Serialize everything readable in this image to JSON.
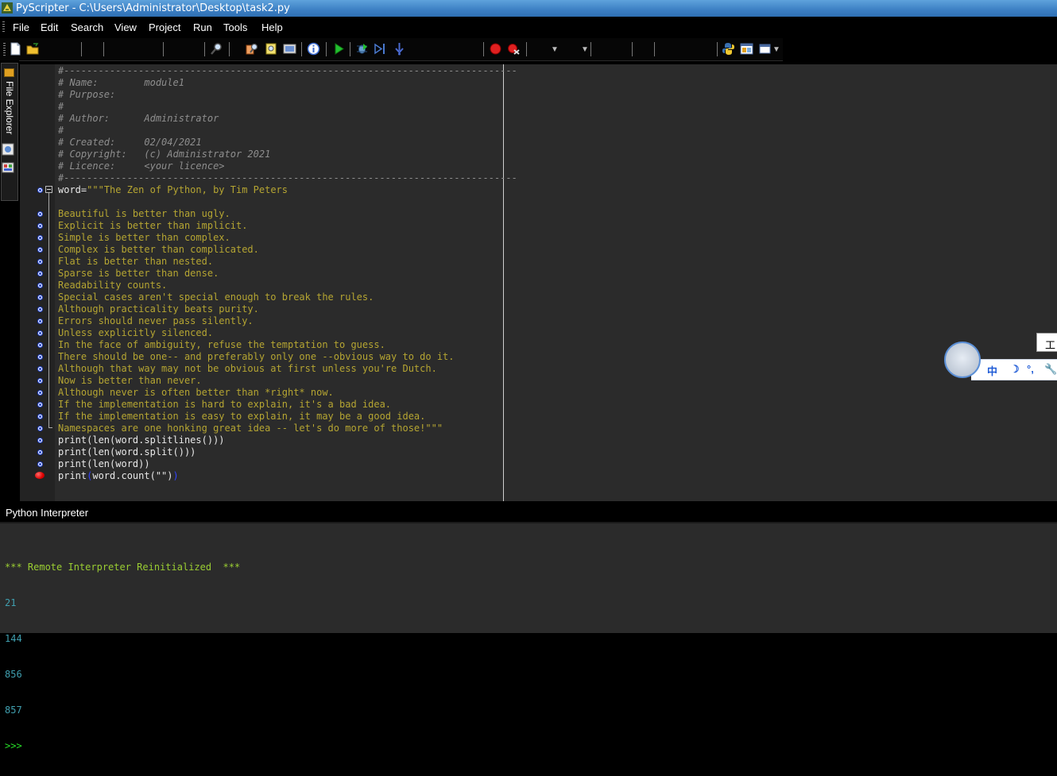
{
  "window": {
    "title": "PyScripter - C:\\Users\\Administrator\\Desktop\\task2.py"
  },
  "menu": [
    "File",
    "Edit",
    "Search",
    "View",
    "Project",
    "Run",
    "Tools",
    "Help"
  ],
  "side_tabs": {
    "file_explorer": "File Explorer"
  },
  "editor": {
    "header_comment": [
      "#-------------------------------------------------------------------------------",
      "# Name:        module1",
      "# Purpose:",
      "#",
      "# Author:      Administrator",
      "#",
      "# Created:     02/04/2021",
      "# Copyright:   (c) Administrator 2021",
      "# Licence:     <your licence>",
      "#-------------------------------------------------------------------------------"
    ],
    "assign_var": "word",
    "assign_eq": "=",
    "string_first": "\"\"\"The Zen of Python, by Tim Peters",
    "string_lines": [
      "",
      "Beautiful is better than ugly.",
      "Explicit is better than implicit.",
      "Simple is better than complex.",
      "Complex is better than complicated.",
      "Flat is better than nested.",
      "Sparse is better than dense.",
      "Readability counts.",
      "Special cases aren't special enough to break the rules.",
      "Although practicality beats purity.",
      "Errors should never pass silently.",
      "Unless explicitly silenced.",
      "In the face of ambiguity, refuse the temptation to guess.",
      "There should be one-- and preferably only one --obvious way to do it.",
      "Although that way may not be obvious at first unless you're Dutch.",
      "Now is better than never.",
      "Although never is often better than *right* now.",
      "If the implementation is hard to explain, it's a bad idea.",
      "If the implementation is easy to explain, it may be a good idea.",
      "Namespaces are one honking great idea -- let's do more of those!\"\"\""
    ],
    "code_lines": [
      "print(len(word.splitlines()))",
      "print(len(word.split()))",
      "print(len(word))"
    ],
    "last_line": {
      "pre": "print",
      "open": "(",
      "mid": "word.count(\"\")",
      "close": ")"
    }
  },
  "interpreter": {
    "title": "Python Interpreter",
    "banner": "*** Remote Interpreter Reinitialized  ***",
    "outputs": [
      "21",
      "144",
      "856",
      "857"
    ],
    "prompt": ">>>"
  },
  "ime": {
    "chars": [
      "中",
      "☽",
      "°,",
      "🔧"
    ],
    "tooltip": "工"
  }
}
